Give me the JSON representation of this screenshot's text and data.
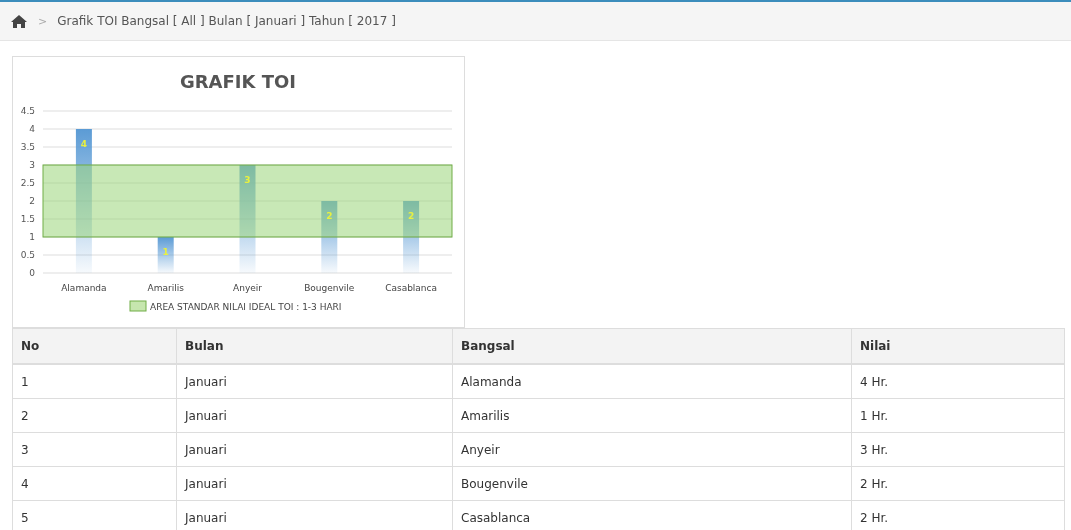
{
  "breadcrumb": {
    "separator": ">",
    "text": "Grafik TOI Bangsal [ All ] Bulan [ Januari ] Tahun [ 2017 ]"
  },
  "chart": {
    "chart_data": {
      "type": "bar",
      "title": "GRAFIK TOI",
      "categories": [
        "Alamanda",
        "Amarilis",
        "Anyeir",
        "Bougenvile",
        "Casablanca"
      ],
      "series": [
        {
          "color": "#5b9bd5",
          "values": [
            4,
            1,
            3,
            2,
            2
          ]
        }
      ],
      "ylim": [
        0,
        4.5
      ],
      "yticks": [
        0,
        0.5,
        1,
        1.5,
        2,
        2.5,
        3,
        3.5,
        4,
        4.5
      ],
      "data_labels": true,
      "grid": true,
      "bands": [
        {
          "axis": "y",
          "from": 1,
          "to": 3,
          "label": "AREA STANDAR NILAI IDEAL TOI : 1-3 HARI",
          "color": "#9bd67a"
        }
      ]
    }
  },
  "table": {
    "columns": [
      "No",
      "Bulan",
      "Bangsal",
      "Nilai"
    ],
    "rows": [
      [
        "1",
        "Januari",
        "Alamanda",
        "4 Hr."
      ],
      [
        "2",
        "Januari",
        "Amarilis",
        "1 Hr."
      ],
      [
        "3",
        "Januari",
        "Anyeir",
        "3 Hr."
      ],
      [
        "4",
        "Januari",
        "Bougenvile",
        "2 Hr."
      ],
      [
        "5",
        "Januari",
        "Casablanca",
        "2 Hr."
      ]
    ]
  }
}
